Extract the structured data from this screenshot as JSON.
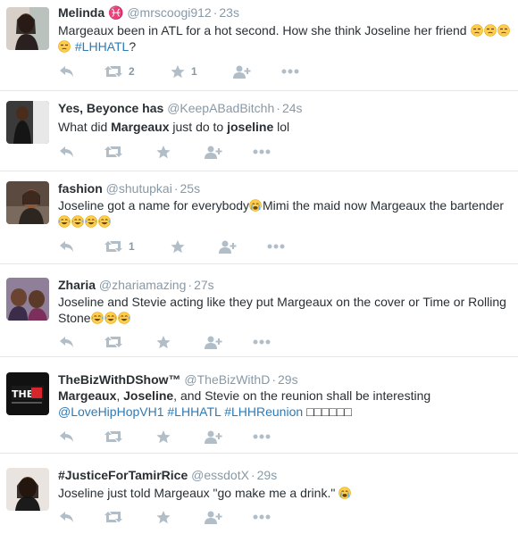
{
  "colors": {
    "link": "#2b7bb9",
    "muted": "#8899a6",
    "text": "#292f33",
    "divider": "#e1e8ed",
    "action_icon": "#b2bec7"
  },
  "tweets": [
    {
      "name": "Melinda ♓",
      "handle": "@mrscoogi912",
      "time": "23s",
      "text": [
        {
          "t": "Margeaux been in ATL for a hot second. How she think Joseline her friend "
        },
        {
          "emoji": "unamused-face-emoji"
        },
        {
          "emoji": "unamused-face-emoji"
        },
        {
          "emoji": "unamused-face-emoji"
        },
        {
          "emoji": "unamused-face-emoji"
        },
        {
          "t": " "
        },
        {
          "t": "#LHHATL",
          "link": true
        },
        {
          "t": "?"
        }
      ],
      "retweet_count": "2",
      "favorite_count": "1"
    },
    {
      "name": "Yes, Beyonce has",
      "handle": "@KeepABadBitchh",
      "time": "24s",
      "text": [
        {
          "t": "What did "
        },
        {
          "t": "Margeaux",
          "bold": true
        },
        {
          "t": " just do to "
        },
        {
          "t": "joseline",
          "bold": true
        },
        {
          "t": " lol"
        }
      ],
      "retweet_count": "",
      "favorite_count": ""
    },
    {
      "name": "fashion",
      "handle": "@shutupkai",
      "time": "25s",
      "text": [
        {
          "t": "Joseline got a name for everybody"
        },
        {
          "emoji": "crying-face-emoji"
        },
        {
          "t": "Mimi the maid now Margeaux the bartender"
        },
        {
          "emoji": "tears-of-joy-emoji"
        },
        {
          "emoji": "tears-of-joy-emoji"
        },
        {
          "emoji": "tears-of-joy-emoji"
        },
        {
          "emoji": "tears-of-joy-emoji"
        }
      ],
      "retweet_count": "1",
      "favorite_count": ""
    },
    {
      "name": "Zharia",
      "handle": "@zhariamazing",
      "time": "27s",
      "text": [
        {
          "t": "Joseline and Stevie acting like they put Margeaux on the cover or Time or Rolling Stone"
        },
        {
          "emoji": "tears-of-joy-emoji"
        },
        {
          "emoji": "tears-of-joy-emoji"
        },
        {
          "emoji": "tears-of-joy-emoji"
        }
      ],
      "retweet_count": "",
      "favorite_count": ""
    },
    {
      "name": "TheBizWithDShow™",
      "handle": "@TheBizWithD",
      "time": "29s",
      "text": [
        {
          "t": "Margeaux",
          "bold": true
        },
        {
          "t": ", "
        },
        {
          "t": "Joseline",
          "bold": true
        },
        {
          "t": ", and Stevie on the reunion shall be interesting "
        },
        {
          "t": "@LoveHipHopVH1",
          "link": true
        },
        {
          "t": " "
        },
        {
          "t": "#LHHATL",
          "link": true
        },
        {
          "t": " "
        },
        {
          "t": "#LHHReunion",
          "link": true
        },
        {
          "t": " □□□□□□"
        }
      ],
      "retweet_count": "",
      "favorite_count": ""
    },
    {
      "name": "#JusticeForTamirRice",
      "handle": "@essdotX",
      "time": "29s",
      "text": [
        {
          "t": "Joseline just told Margeaux \"go make me a drink.\" "
        },
        {
          "emoji": "crying-face-emoji"
        }
      ],
      "retweet_count": "",
      "favorite_count": ""
    }
  ]
}
